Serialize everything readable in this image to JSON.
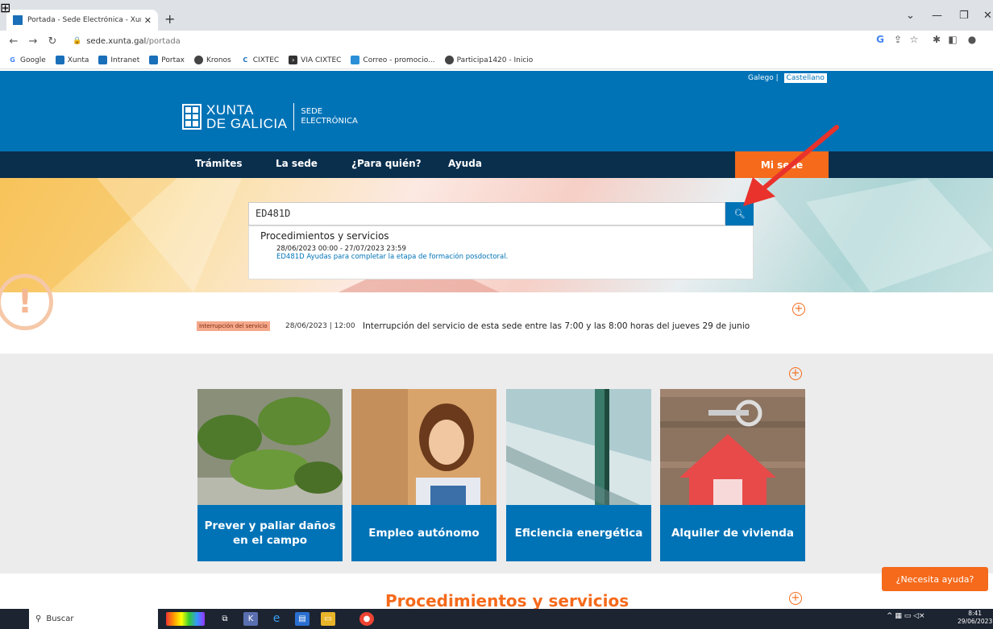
{
  "browser": {
    "tab_title": "Portada - Sede Electrónica - Xunt",
    "new_tab": "+",
    "url_host": "sede.xunta.gal",
    "url_path": "/portada",
    "bookmarks": [
      "Google",
      "Xunta",
      "Intranet",
      "Portax",
      "Kronos",
      "CIXTEC",
      "VIA CIXTEC",
      "Correo - promocio...",
      "Participa1420 - Inicio"
    ]
  },
  "header": {
    "lang_gl": "Galego",
    "lang_sep": "|",
    "lang_es": "Castellano",
    "logo_line1": "XUNTA",
    "logo_line2": "DE GALICIA",
    "sede_line1": "SEDE",
    "sede_line2": "ELECTRÓNICA"
  },
  "menu": {
    "items": [
      "Trámites",
      "La sede",
      "¿Para quién?",
      "Ayuda"
    ],
    "mi_sede": "Mi sede"
  },
  "search": {
    "value": "ED481D",
    "results_heading": "Procedimientos y servicios",
    "result_dates": "28/06/2023 00:00 - 27/07/2023 23:59",
    "result_link": "ED481D Ayudas para completar la etapa de formación posdoctoral."
  },
  "alert": {
    "badge": "Interrupción del servicio",
    "date": "28/06/2023 | 12:00",
    "text": "Interrupción del servicio de esta sede entre las 7:00 y las 8:00 horas del jueves 29 de junio"
  },
  "cards": [
    {
      "label": "Prever y paliar daños en el campo"
    },
    {
      "label": "Empleo autónomo"
    },
    {
      "label": "Eficiencia energética"
    },
    {
      "label": "Alquiler de vivienda"
    }
  ],
  "procedures_heading": "Procedimientos y servicios",
  "help_button": "¿Necesita ayuda?",
  "taskbar": {
    "search_placeholder": "Buscar",
    "time": "8:41",
    "date": "29/06/2023"
  },
  "colors": {
    "brand_blue": "#0073b7",
    "navy": "#0a2f4d",
    "accent_orange": "#f56a1b",
    "annotation_arrow": "#e8322b"
  }
}
